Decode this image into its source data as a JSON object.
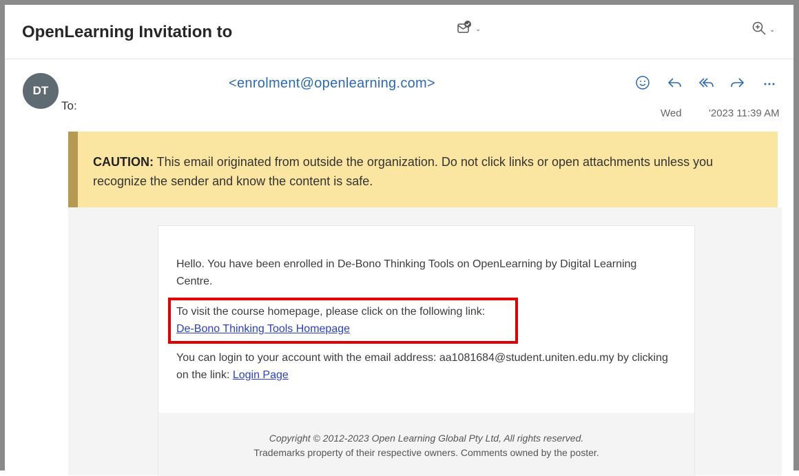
{
  "header": {
    "subject": "OpenLearning Invitation to",
    "subject_icon": "mail-check-icon",
    "zoom_icon": "zoom-in-icon"
  },
  "message": {
    "avatar_initials": "DT",
    "sender_email": "<enrolment@openlearning.com>",
    "to_label": "To:",
    "date_day": "Wed",
    "date_time": "'2023 11:39 AM",
    "actions": [
      "emoji-icon",
      "reply-icon",
      "reply-all-icon",
      "forward-icon",
      "more-icon"
    ]
  },
  "caution": {
    "label": "CAUTION:",
    "text": " This email originated from outside the organization. Do not click links or open attachments unless you recognize the sender and know the content is safe."
  },
  "body": {
    "p1": "Hello. You have been enrolled in De-Bono Thinking Tools on OpenLearning by Digital Learning Centre.",
    "p2_text": "To visit the course homepage, please click on the following link:",
    "p2_link": "De-Bono Thinking Tools Homepage",
    "p3_text": "You can login to your account with the email address: aa1081684@student.uniten.edu.my by clicking on the link: ",
    "p3_link": "Login Page"
  },
  "footer": {
    "line1": "Copyright © 2012-2023 Open Learning Global Pty Ltd, All rights reserved.",
    "line2": "Trademarks property of their respective owners. Comments owned by the poster."
  },
  "colors": {
    "accent_link": "#2b69b5",
    "caution_bg": "#fbe6a1",
    "caution_border": "#b59a50",
    "highlight": "#e00000"
  }
}
